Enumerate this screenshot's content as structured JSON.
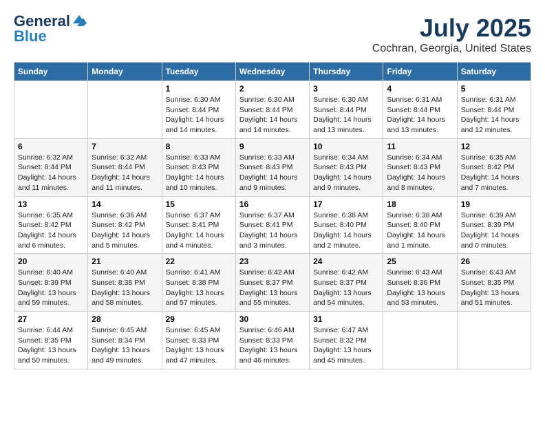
{
  "header": {
    "logo_general": "General",
    "logo_blue": "Blue",
    "title": "July 2025",
    "subtitle": "Cochran, Georgia, United States"
  },
  "weekdays": [
    "Sunday",
    "Monday",
    "Tuesday",
    "Wednesday",
    "Thursday",
    "Friday",
    "Saturday"
  ],
  "weeks": [
    [
      {
        "day": "",
        "info": ""
      },
      {
        "day": "",
        "info": ""
      },
      {
        "day": "1",
        "info": "Sunrise: 6:30 AM\nSunset: 8:44 PM\nDaylight: 14 hours and 14 minutes."
      },
      {
        "day": "2",
        "info": "Sunrise: 6:30 AM\nSunset: 8:44 PM\nDaylight: 14 hours and 14 minutes."
      },
      {
        "day": "3",
        "info": "Sunrise: 6:30 AM\nSunset: 8:44 PM\nDaylight: 14 hours and 13 minutes."
      },
      {
        "day": "4",
        "info": "Sunrise: 6:31 AM\nSunset: 8:44 PM\nDaylight: 14 hours and 13 minutes."
      },
      {
        "day": "5",
        "info": "Sunrise: 6:31 AM\nSunset: 8:44 PM\nDaylight: 14 hours and 12 minutes."
      }
    ],
    [
      {
        "day": "6",
        "info": "Sunrise: 6:32 AM\nSunset: 8:44 PM\nDaylight: 14 hours and 11 minutes."
      },
      {
        "day": "7",
        "info": "Sunrise: 6:32 AM\nSunset: 8:44 PM\nDaylight: 14 hours and 11 minutes."
      },
      {
        "day": "8",
        "info": "Sunrise: 6:33 AM\nSunset: 8:43 PM\nDaylight: 14 hours and 10 minutes."
      },
      {
        "day": "9",
        "info": "Sunrise: 6:33 AM\nSunset: 8:43 PM\nDaylight: 14 hours and 9 minutes."
      },
      {
        "day": "10",
        "info": "Sunrise: 6:34 AM\nSunset: 8:43 PM\nDaylight: 14 hours and 9 minutes."
      },
      {
        "day": "11",
        "info": "Sunrise: 6:34 AM\nSunset: 8:43 PM\nDaylight: 14 hours and 8 minutes."
      },
      {
        "day": "12",
        "info": "Sunrise: 6:35 AM\nSunset: 8:42 PM\nDaylight: 14 hours and 7 minutes."
      }
    ],
    [
      {
        "day": "13",
        "info": "Sunrise: 6:35 AM\nSunset: 8:42 PM\nDaylight: 14 hours and 6 minutes."
      },
      {
        "day": "14",
        "info": "Sunrise: 6:36 AM\nSunset: 8:42 PM\nDaylight: 14 hours and 5 minutes."
      },
      {
        "day": "15",
        "info": "Sunrise: 6:37 AM\nSunset: 8:41 PM\nDaylight: 14 hours and 4 minutes."
      },
      {
        "day": "16",
        "info": "Sunrise: 6:37 AM\nSunset: 8:41 PM\nDaylight: 14 hours and 3 minutes."
      },
      {
        "day": "17",
        "info": "Sunrise: 6:38 AM\nSunset: 8:40 PM\nDaylight: 14 hours and 2 minutes."
      },
      {
        "day": "18",
        "info": "Sunrise: 6:38 AM\nSunset: 8:40 PM\nDaylight: 14 hours and 1 minute."
      },
      {
        "day": "19",
        "info": "Sunrise: 6:39 AM\nSunset: 8:39 PM\nDaylight: 14 hours and 0 minutes."
      }
    ],
    [
      {
        "day": "20",
        "info": "Sunrise: 6:40 AM\nSunset: 8:39 PM\nDaylight: 13 hours and 59 minutes."
      },
      {
        "day": "21",
        "info": "Sunrise: 6:40 AM\nSunset: 8:38 PM\nDaylight: 13 hours and 58 minutes."
      },
      {
        "day": "22",
        "info": "Sunrise: 6:41 AM\nSunset: 8:38 PM\nDaylight: 13 hours and 57 minutes."
      },
      {
        "day": "23",
        "info": "Sunrise: 6:42 AM\nSunset: 8:37 PM\nDaylight: 13 hours and 55 minutes."
      },
      {
        "day": "24",
        "info": "Sunrise: 6:42 AM\nSunset: 8:37 PM\nDaylight: 13 hours and 54 minutes."
      },
      {
        "day": "25",
        "info": "Sunrise: 6:43 AM\nSunset: 8:36 PM\nDaylight: 13 hours and 53 minutes."
      },
      {
        "day": "26",
        "info": "Sunrise: 6:43 AM\nSunset: 8:35 PM\nDaylight: 13 hours and 51 minutes."
      }
    ],
    [
      {
        "day": "27",
        "info": "Sunrise: 6:44 AM\nSunset: 8:35 PM\nDaylight: 13 hours and 50 minutes."
      },
      {
        "day": "28",
        "info": "Sunrise: 6:45 AM\nSunset: 8:34 PM\nDaylight: 13 hours and 49 minutes."
      },
      {
        "day": "29",
        "info": "Sunrise: 6:45 AM\nSunset: 8:33 PM\nDaylight: 13 hours and 47 minutes."
      },
      {
        "day": "30",
        "info": "Sunrise: 6:46 AM\nSunset: 8:33 PM\nDaylight: 13 hours and 46 minutes."
      },
      {
        "day": "31",
        "info": "Sunrise: 6:47 AM\nSunset: 8:32 PM\nDaylight: 13 hours and 45 minutes."
      },
      {
        "day": "",
        "info": ""
      },
      {
        "day": "",
        "info": ""
      }
    ]
  ]
}
